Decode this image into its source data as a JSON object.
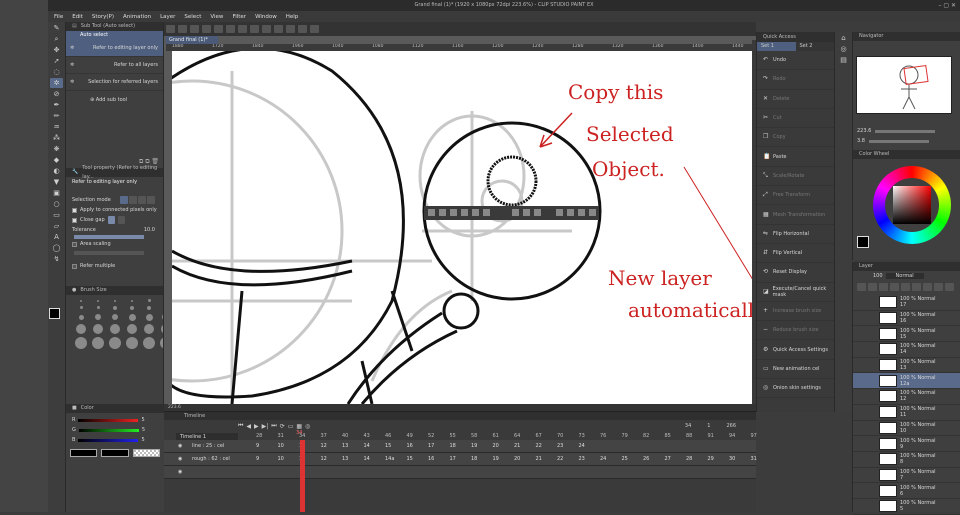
{
  "window": {
    "title": "Grand final (1)* (1920 x 1080px 72dpi 223.6%) - CLIP STUDIO PAINT EX",
    "controls": "–  ▢  ✕"
  },
  "menu": [
    "File",
    "Edit",
    "Story(P)",
    "Animation",
    "Layer",
    "Select",
    "View",
    "Filter",
    "Window",
    "Help"
  ],
  "subtool": {
    "header": "Sub Tool (Auto select)",
    "tab": "Auto select",
    "items": [
      "Refer to editing layer only",
      "Refer to all layers",
      "Selection for referred layers"
    ],
    "add": "Add sub tool"
  },
  "toolprop": {
    "header": "Tool property (Refer to editing lay...",
    "title": "Refer to editing layer only",
    "selection_mode": "Selection mode",
    "apply": "Apply to connected pixels only",
    "close_gap": "Close gap",
    "tolerance_label": "Tolerance",
    "tolerance_value": "10.0",
    "area_scaling": "Area scaling",
    "refer_multiple": "Refer multiple"
  },
  "brushsize": {
    "header": "Brush Size"
  },
  "color": {
    "header": "Color",
    "channels": [
      {
        "ch": "R",
        "val": "5"
      },
      {
        "ch": "G",
        "val": "5"
      },
      {
        "ch": "B",
        "val": "5"
      }
    ]
  },
  "canvas": {
    "doc_tab": "Grand final (1)*",
    "ruler": [
      "1880",
      "1720",
      "1840",
      "1960",
      "1040",
      "1080",
      "1120",
      "1160",
      "1200",
      "1240",
      "1280",
      "1320",
      "1360",
      "1400",
      "1440"
    ],
    "status": "223.6"
  },
  "annotations": {
    "copy_line1": "Copy this",
    "copy_line2": "Selected",
    "copy_line3": "Object.",
    "newlayer_line1": "New layer",
    "newlayer_line2": "automatically"
  },
  "quickaccess": {
    "header": "Quick Access",
    "tabs": [
      "Set 1",
      "Set 2"
    ],
    "items": [
      {
        "icon": "undo-icon",
        "glyph": "↶",
        "label": "Undo",
        "enabled": true
      },
      {
        "icon": "redo-icon",
        "glyph": "↷",
        "label": "Redo",
        "enabled": false
      },
      {
        "icon": "delete-icon",
        "glyph": "✕",
        "label": "Delete",
        "enabled": false
      },
      {
        "icon": "cut-icon",
        "glyph": "✂",
        "label": "Cut",
        "enabled": false
      },
      {
        "icon": "copy-icon",
        "glyph": "❐",
        "label": "Copy",
        "enabled": false
      },
      {
        "icon": "paste-icon",
        "glyph": "📋",
        "label": "Paste",
        "enabled": true
      },
      {
        "icon": "scale-icon",
        "glyph": "⤡",
        "label": "Scale/Rotate",
        "enabled": false
      },
      {
        "icon": "free-transform-icon",
        "glyph": "⤢",
        "label": "Free Transform",
        "enabled": false
      },
      {
        "icon": "mesh-icon",
        "glyph": "▦",
        "label": "Mesh Transformation",
        "enabled": false
      },
      {
        "icon": "flip-h-icon",
        "glyph": "⇋",
        "label": "Flip Horizontal",
        "enabled": true
      },
      {
        "icon": "flip-v-icon",
        "glyph": "⇵",
        "label": "Flip Vertical",
        "enabled": true
      },
      {
        "icon": "reset-display-icon",
        "glyph": "⟲",
        "label": "Reset Display",
        "enabled": true
      },
      {
        "icon": "quick-mask-icon",
        "glyph": "◪",
        "label": "Execute/Cancel quick mask",
        "enabled": true
      },
      {
        "icon": "increase-brush-icon",
        "glyph": "+",
        "label": "Increase brush size",
        "enabled": false
      },
      {
        "icon": "reduce-brush-icon",
        "glyph": "−",
        "label": "Reduce brush size",
        "enabled": false
      },
      {
        "icon": "qa-settings-icon",
        "glyph": "⚙",
        "label": "Quick Access Settings",
        "enabled": true
      },
      {
        "icon": "new-cel-icon",
        "glyph": "▭",
        "label": "New animation cel",
        "enabled": true
      },
      {
        "icon": "onion-skin-icon",
        "glyph": "◎",
        "label": "Onion skin settings",
        "enabled": true
      }
    ]
  },
  "navigator": {
    "header": "Navigator",
    "zoom": "223.6",
    "angle": "3.8"
  },
  "colorwheel": {
    "header": "Color Wheel"
  },
  "layers": {
    "header": "Layer",
    "blend": "Normal",
    "opacity": "100",
    "items": [
      {
        "label": "100 % Normal",
        "name": "17",
        "selected": false
      },
      {
        "label": "100 % Normal",
        "name": "16",
        "selected": false
      },
      {
        "label": "100 % Normal",
        "name": "15",
        "selected": false
      },
      {
        "label": "100 % Normal",
        "name": "14",
        "selected": false
      },
      {
        "label": "100 % Normal",
        "name": "13",
        "selected": false
      },
      {
        "label": "100 % Normal",
        "name": "12a",
        "selected": true
      },
      {
        "label": "100 % Normal",
        "name": "12",
        "selected": false
      },
      {
        "label": "100 % Normal",
        "name": "11",
        "selected": false
      },
      {
        "label": "100 % Normal",
        "name": "10",
        "selected": false
      },
      {
        "label": "100 % Normal",
        "name": "9",
        "selected": false
      },
      {
        "label": "100 % Normal",
        "name": "8",
        "selected": false
      },
      {
        "label": "100 % Normal",
        "name": "7",
        "selected": false
      },
      {
        "label": "100 % Normal",
        "name": "6",
        "selected": false
      },
      {
        "label": "100 % Normal",
        "name": "5",
        "selected": false
      }
    ]
  },
  "timeline": {
    "header": "Timeline",
    "tab": "Timeline 1",
    "frame_current": "34",
    "frame_start": "1",
    "frame_end": "266",
    "frame_mid": "34",
    "frames": [
      "28",
      "31",
      "34",
      "37",
      "40",
      "43",
      "46",
      "49",
      "52",
      "55",
      "58",
      "61",
      "64",
      "67",
      "70",
      "73",
      "76",
      "79",
      "82",
      "85",
      "88",
      "91",
      "94",
      "97"
    ],
    "tracks": [
      {
        "name": "line : 25 : cel",
        "cells": [
          "9",
          "10",
          "11",
          "12",
          "13",
          "14",
          "15",
          "16",
          "17",
          "18",
          "19",
          "20",
          "21",
          "22",
          "23",
          "24"
        ]
      },
      {
        "name": "rough : 62 : cel",
        "cells": [
          "9",
          "10",
          "11",
          "12",
          "13",
          "14",
          "14a",
          "15",
          "16",
          "17",
          "18",
          "19",
          "20",
          "21",
          "22",
          "23",
          "24",
          "25",
          "26",
          "27",
          "28",
          "29",
          "30",
          "31"
        ]
      },
      {
        "name": "",
        "cells": []
      }
    ]
  }
}
